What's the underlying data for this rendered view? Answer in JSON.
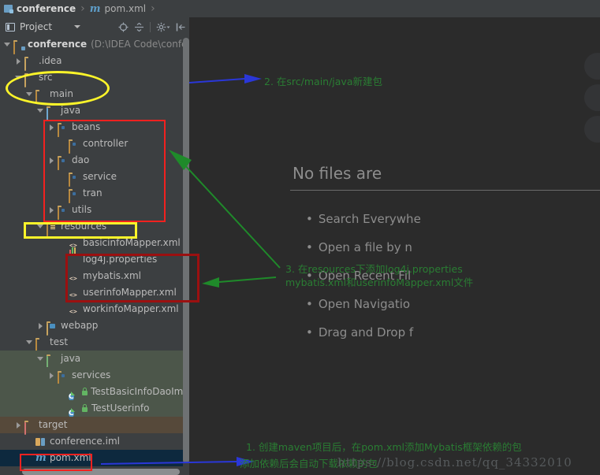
{
  "breadcrumb": {
    "items": [
      {
        "label": "conference",
        "icon": "project-module-icon"
      },
      {
        "label": "pom.xml",
        "icon": "maven-m-icon"
      }
    ],
    "separator": "›"
  },
  "tool_window": {
    "title": "Project",
    "title_icon": "project-panel-icon",
    "dropdown_icon": "chevron-down-icon",
    "actions": [
      {
        "name": "locate-icon"
      },
      {
        "name": "collapse-all-icon"
      },
      {
        "name": "settings-gear-icon"
      },
      {
        "name": "hide-panel-icon"
      }
    ]
  },
  "tree": {
    "nodes": [
      {
        "label": "conference",
        "path": "(D:\\IDEA Code\\conferenc",
        "indent": 0,
        "arrow": "down",
        "icon": "module-root-folder-icon",
        "bold": true,
        "row": "plain"
      },
      {
        "label": ".idea",
        "path": "",
        "indent": 1,
        "arrow": "right",
        "icon": "folder-icon",
        "bold": false,
        "row": "plain"
      },
      {
        "label": "src",
        "path": "",
        "indent": 1,
        "arrow": "down",
        "icon": "folder-icon",
        "bold": false,
        "row": "plain"
      },
      {
        "label": "main",
        "path": "",
        "indent": 2,
        "arrow": "down",
        "icon": "folder-filled-icon",
        "bold": false,
        "row": "plain"
      },
      {
        "label": "java",
        "path": "",
        "indent": 3,
        "arrow": "down",
        "icon": "source-root-folder-icon",
        "bold": false,
        "row": "plain"
      },
      {
        "label": "beans",
        "path": "",
        "indent": 4,
        "arrow": "right",
        "icon": "package-icon",
        "bold": false,
        "row": "plain"
      },
      {
        "label": "controller",
        "path": "",
        "indent": 5,
        "arrow": "none",
        "icon": "package-icon",
        "bold": false,
        "row": "plain"
      },
      {
        "label": "dao",
        "path": "",
        "indent": 4,
        "arrow": "right",
        "icon": "package-icon",
        "bold": false,
        "row": "plain"
      },
      {
        "label": "service",
        "path": "",
        "indent": 5,
        "arrow": "none",
        "icon": "package-icon",
        "bold": false,
        "row": "plain"
      },
      {
        "label": "tran",
        "path": "",
        "indent": 5,
        "arrow": "none",
        "icon": "package-icon",
        "bold": false,
        "row": "plain"
      },
      {
        "label": "utils",
        "path": "",
        "indent": 4,
        "arrow": "right",
        "icon": "package-icon",
        "bold": false,
        "row": "plain"
      },
      {
        "label": "resources",
        "path": "",
        "indent": 3,
        "arrow": "down",
        "icon": "resources-root-folder-icon",
        "bold": false,
        "row": "plain"
      },
      {
        "label": "basicinfoMapper.xml",
        "path": "",
        "indent": 5,
        "arrow": "none",
        "icon": "xml-file-icon",
        "bold": false,
        "row": "plain"
      },
      {
        "label": "log4j.properties",
        "path": "",
        "indent": 5,
        "arrow": "none",
        "icon": "properties-file-icon",
        "bold": false,
        "row": "plain"
      },
      {
        "label": "mybatis.xml",
        "path": "",
        "indent": 5,
        "arrow": "none",
        "icon": "xml-file-icon",
        "bold": false,
        "row": "plain"
      },
      {
        "label": "userinfoMapper.xml",
        "path": "",
        "indent": 5,
        "arrow": "none",
        "icon": "xml-file-icon",
        "bold": false,
        "row": "plain"
      },
      {
        "label": "workinfoMapper.xml",
        "path": "",
        "indent": 5,
        "arrow": "none",
        "icon": "xml-file-icon",
        "bold": false,
        "row": "plain"
      },
      {
        "label": "webapp",
        "path": "",
        "indent": 3,
        "arrow": "right",
        "icon": "webapp-folder-icon",
        "bold": false,
        "row": "plain"
      },
      {
        "label": "test",
        "path": "",
        "indent": 2,
        "arrow": "down",
        "icon": "folder-filled-icon",
        "bold": false,
        "row": "plain"
      },
      {
        "label": "java",
        "path": "",
        "indent": 3,
        "arrow": "down",
        "icon": "test-source-root-folder-icon",
        "bold": false,
        "row": "testroot"
      },
      {
        "label": "services",
        "path": "",
        "indent": 4,
        "arrow": "right",
        "icon": "package-icon",
        "bold": false,
        "row": "testroot"
      },
      {
        "label": "TestBasicInfoDaoImp",
        "path": "",
        "indent": 5,
        "arrow": "none",
        "icon": "test-class-icon",
        "bold": false,
        "row": "testroot"
      },
      {
        "label": "TestUserinfo",
        "path": "",
        "indent": 5,
        "arrow": "none",
        "icon": "test-class-icon",
        "bold": false,
        "row": "testroot"
      },
      {
        "label": "target",
        "path": "",
        "indent": 1,
        "arrow": "right",
        "icon": "excluded-folder-icon",
        "bold": false,
        "row": "targetroot"
      },
      {
        "label": "conference.iml",
        "path": "",
        "indent": 2,
        "arrow": "none",
        "icon": "iml-file-icon",
        "bold": false,
        "row": "plain"
      },
      {
        "label": "pom.xml",
        "path": "",
        "indent": 2,
        "arrow": "none",
        "icon": "maven-m-icon",
        "bold": false,
        "row": "selected"
      }
    ]
  },
  "editor": {
    "welcome_title": "No files are",
    "tips": [
      "Search Everywhe",
      "Open a file by n",
      "Open Recent Fil",
      "Open Navigatio",
      "Drag and Drop f"
    ],
    "bullet": "•"
  },
  "annotations": {
    "note2_line1": "2. 在src/main/java新建包",
    "note3_line1": "3. 在resources下添加log4j.properties",
    "note3_line2": "mybatis.xml和userinfoMapper.xml文件",
    "note1_line1": "1. 创建maven项目后，在pom.xml添加Mybatis框架依赖的包",
    "note1_line2": "添加依赖后会自动下载依赖的包",
    "watermark": "https://blog.csdn.net/qq_34332010",
    "colors": {
      "green_text": "#2a7d33",
      "red_box": "#f2211f",
      "dark_red_box": "#9b1010",
      "yellow_mark": "#fbf42a",
      "blue_arrow": "#2a37d8",
      "green_arrow": "#1f8a2a",
      "watermark_gray": "#565a5c"
    }
  }
}
